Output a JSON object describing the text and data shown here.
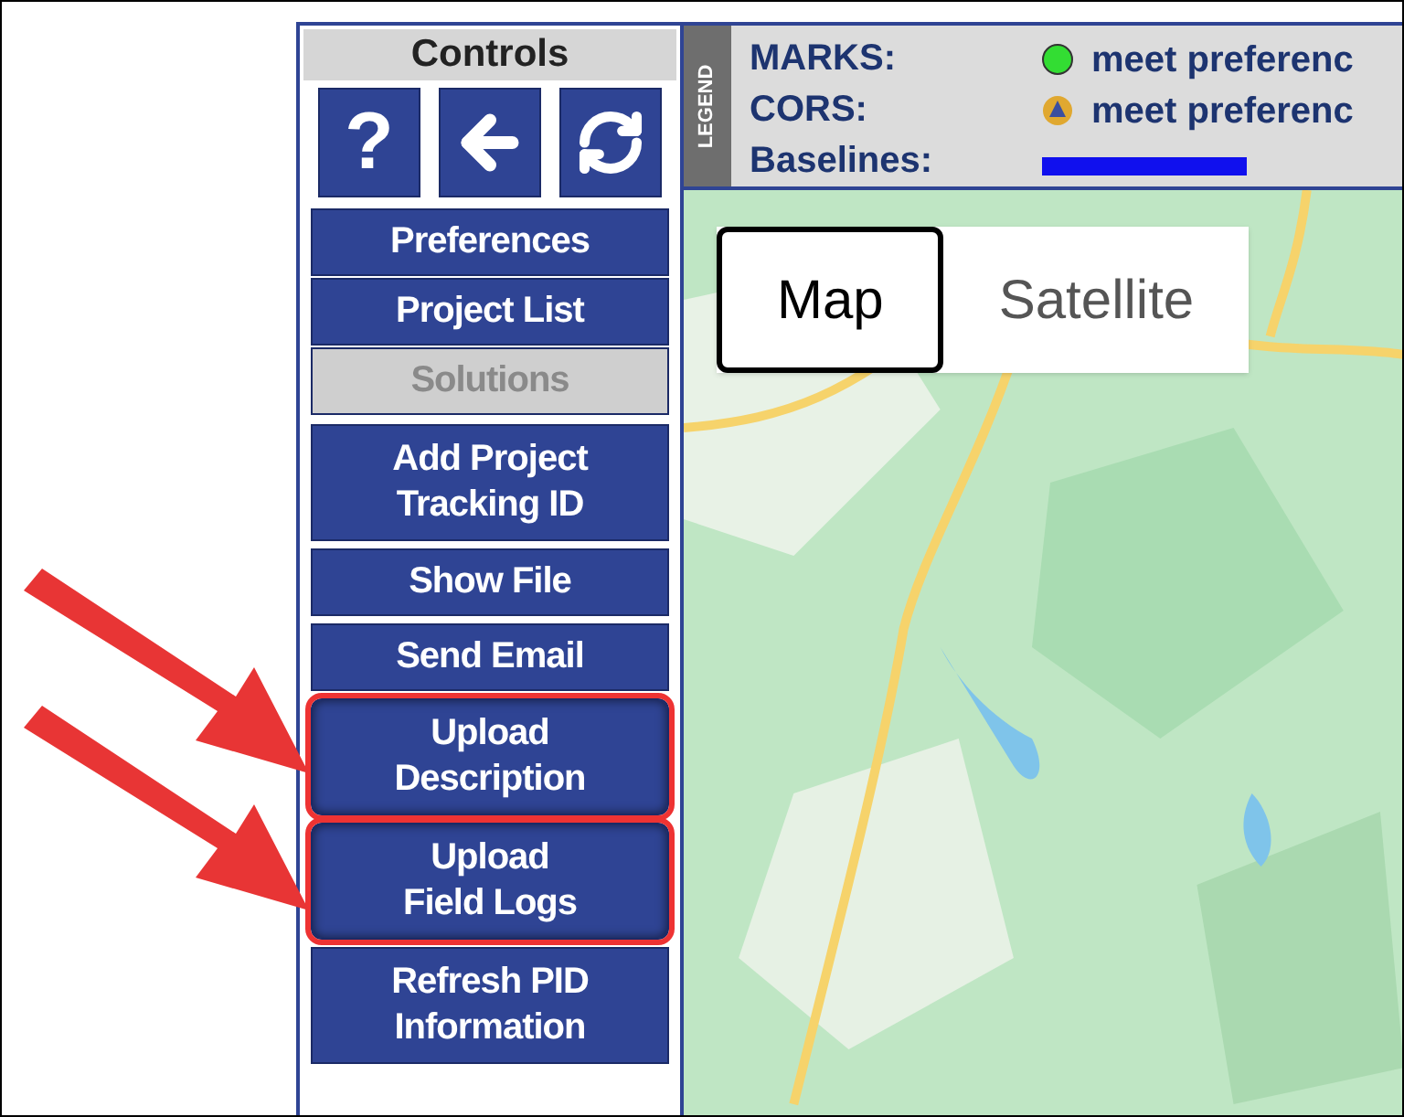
{
  "controls": {
    "title": "Controls",
    "tool_buttons": [
      {
        "kind": "text",
        "label": "?"
      },
      {
        "kind": "back"
      },
      {
        "kind": "refresh"
      }
    ],
    "top_buttons": [
      {
        "label": "Preferences",
        "disabled": false
      },
      {
        "label": "Project List",
        "disabled": false
      },
      {
        "label": "Solutions",
        "disabled": true
      }
    ],
    "buttons": [
      {
        "label": "Add Project\nTracking ID",
        "highlighted": false
      },
      {
        "label": "Show File",
        "highlighted": false
      },
      {
        "label": "Send Email",
        "highlighted": false
      },
      {
        "label": "Upload\nDescription",
        "highlighted": true
      },
      {
        "label": "Upload\nField Logs",
        "highlighted": true
      },
      {
        "label": "Refresh PID\nInformation",
        "highlighted": false
      }
    ]
  },
  "legend": {
    "tab": "LEGEND",
    "rows": [
      {
        "label": "MARKS:",
        "kind": "dot",
        "color": "#33dd33",
        "text": "meet preferenc"
      },
      {
        "label": "CORS:",
        "kind": "cors",
        "text": "meet preferenc"
      },
      {
        "label": "Baselines:",
        "kind": "line",
        "color": "#1010ee"
      }
    ]
  },
  "map": {
    "map_types": [
      {
        "label": "Map",
        "selected": true
      },
      {
        "label": "Satellite",
        "selected": false
      }
    ]
  }
}
